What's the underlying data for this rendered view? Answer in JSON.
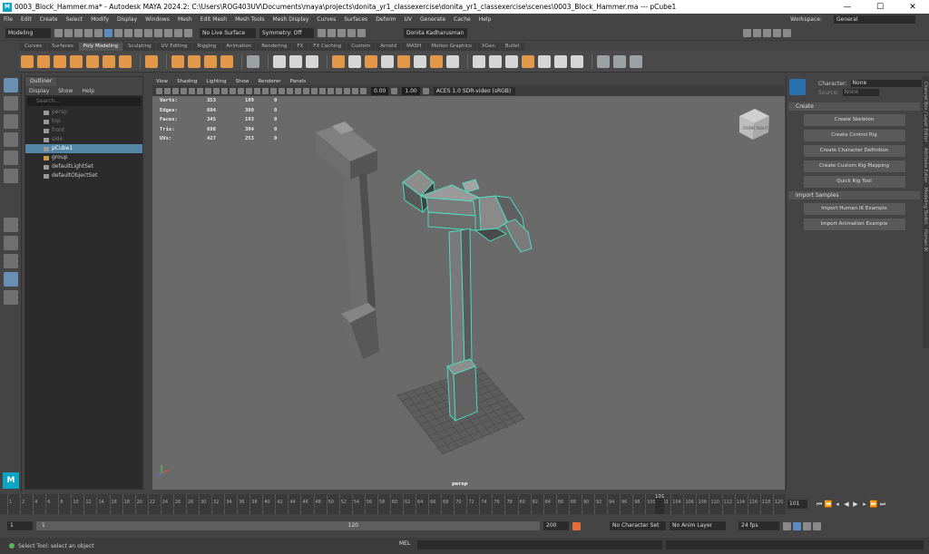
{
  "window": {
    "title": "0003_Block_Hammer.ma* - Autodesk MAYA 2024.2: C:\\Users\\ROG403UV\\Documents\\maya\\projects\\donita_yr1_classexercise\\donita_yr1_classexercise\\scenes\\0003_Block_Hammer.ma  ---  pCube1",
    "minimize": "—",
    "maximize": "☐",
    "close": "✕"
  },
  "menubar": {
    "items": [
      "File",
      "Edit",
      "Create",
      "Select",
      "Modify",
      "Display",
      "Windows",
      "Mesh",
      "Edit Mesh",
      "Mesh Tools",
      "Mesh Display",
      "Curves",
      "Surfaces",
      "Deform",
      "UV",
      "Generate",
      "Cache",
      "Help"
    ],
    "workspace_label": "Workspace:",
    "workspace_value": "General"
  },
  "statusline": {
    "mode": "Modeling",
    "live_surface": "No Live Surface",
    "symmetry": "Symmetry: Off",
    "user": "Donita Kadharusman"
  },
  "shelf_tabs": [
    "Curves",
    "Surfaces",
    "Poly Modeling",
    "Sculpting",
    "UV Editing",
    "Rigging",
    "Animation",
    "Rendering",
    "FX",
    "FX Caching",
    "Custom",
    "Arnold",
    "MASH",
    "Motion Graphics",
    "XGen",
    "Bullet"
  ],
  "outliner": {
    "title": "Outliner",
    "menu": [
      "Display",
      "Show",
      "Help"
    ],
    "search_placeholder": "Search...",
    "items": [
      {
        "label": "persp",
        "dim": true
      },
      {
        "label": "top",
        "dim": true
      },
      {
        "label": "front",
        "dim": true
      },
      {
        "label": "side",
        "dim": true
      },
      {
        "label": "pCube1",
        "selected": true
      },
      {
        "label": "group"
      },
      {
        "label": "defaultLightSet"
      },
      {
        "label": "defaultObjectSet"
      }
    ]
  },
  "viewport": {
    "menu": [
      "View",
      "Shading",
      "Lighting",
      "Show",
      "Renderer",
      "Panels"
    ],
    "exposure": "0.00",
    "gamma": "1.00",
    "colorspace": "ACES 1.0 SDR-video (sRGB)",
    "camera": "persp",
    "hud": [
      {
        "label": "Verts:",
        "a": "353",
        "b": "199",
        "c": "0"
      },
      {
        "label": "Edges:",
        "a": "694",
        "b": "390",
        "c": "0"
      },
      {
        "label": "Faces:",
        "a": "345",
        "b": "193",
        "c": "0"
      },
      {
        "label": "Tris:",
        "a": "698",
        "b": "394",
        "c": "0"
      },
      {
        "label": "UVs:",
        "a": "427",
        "b": "253",
        "c": "0"
      }
    ],
    "viewcube": {
      "front": "FRONT",
      "right": "RIGHT"
    }
  },
  "hik": {
    "character_label": "Character:",
    "character_value": "None",
    "source_label": "Source:",
    "source_value": "None",
    "create_section": "Create",
    "create_buttons": [
      "Create Skeleton",
      "Create Control Rig",
      "Create Character Definition",
      "Create Custom Rig Mapping",
      "Quick Rig Tool"
    ],
    "import_section": "Import Samples",
    "import_buttons": [
      "Import Human IK Example",
      "Import Animation Example"
    ]
  },
  "side_tabs": [
    "Channel Box / Layer Editor",
    "Attribute Editor",
    "Modeling Toolkit",
    "Human IK"
  ],
  "timeline": {
    "ticks": [
      "1",
      "2",
      "4",
      "6",
      "8",
      "10",
      "12",
      "14",
      "16",
      "18",
      "20",
      "22",
      "24",
      "26",
      "28",
      "30",
      "32",
      "34",
      "36",
      "38",
      "40",
      "42",
      "44",
      "46",
      "48",
      "50",
      "52",
      "54",
      "56",
      "58",
      "60",
      "62",
      "64",
      "66",
      "68",
      "70",
      "72",
      "74",
      "76",
      "78",
      "80",
      "82",
      "84",
      "86",
      "88",
      "90",
      "92",
      "94",
      "96",
      "98",
      "100",
      "102",
      "104",
      "106",
      "108",
      "110",
      "112",
      "114",
      "116",
      "118",
      "120"
    ],
    "current": "101",
    "current_field": "101"
  },
  "range": {
    "start": "1",
    "inner_start": "1",
    "inner_end": "120",
    "end": "200",
    "character_set": "No Character Set",
    "anim_layer": "No Anim Layer",
    "fps": "24 fps"
  },
  "helpline": {
    "text": "Select Tool: select an object",
    "mel": "MEL"
  }
}
